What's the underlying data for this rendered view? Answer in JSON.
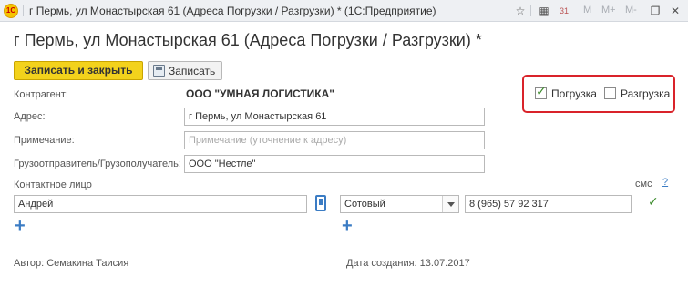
{
  "window": {
    "title": "г Пермь, ул Монастырская 61 (Адреса Погрузки / Разгрузки) *",
    "app": "(1С:Предприятие)",
    "logo_text": "1С",
    "m_label": "M",
    "mplus_label": "M+",
    "mminus_label": "M-",
    "calendar_day": "31"
  },
  "page": {
    "title": "г Пермь, ул Монастырская 61 (Адреса Погрузки / Разгрузки) *"
  },
  "toolbar": {
    "save_close_label": "Записать и закрыть",
    "save_label": "Записать"
  },
  "form": {
    "counterparty_label": "Контрагент:",
    "counterparty_value": "ООО \"УМНАЯ ЛОГИСТИКА\"",
    "address_label": "Адрес:",
    "address_value": "г Пермь, ул Монастырская 61",
    "note_label": "Примечание:",
    "note_placeholder": "Примечание (уточнение к адресу)",
    "shipper_label": "Грузоотправитель/Грузополучатель:",
    "shipper_value": "ООО \"Нестле\"",
    "loading_label": "Погрузка",
    "loading_checked": true,
    "unloading_label": "Разгрузка",
    "unloading_checked": false
  },
  "contact": {
    "label": "Контактное лицо",
    "name": "Андрей",
    "phone_type": "Сотовый",
    "phone": "8 (965) 57 92 317",
    "sms_label": "смс",
    "sms_help": "?",
    "sms_checked": true,
    "plus": "+"
  },
  "footer": {
    "author": "Автор: Семакина Таисия",
    "created": "Дата создания: 13.07.2017"
  },
  "colors": {
    "accent_yellow": "#f3d21c",
    "highlight_red": "#d9232a",
    "link_blue": "#3b7cc4",
    "check_green": "#3a8a2a"
  }
}
